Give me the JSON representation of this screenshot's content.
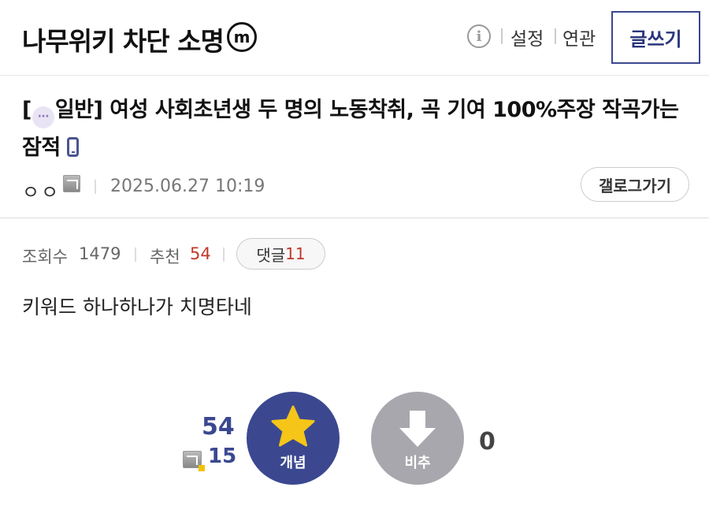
{
  "header": {
    "gallery_title": "나무위키 차단 소명",
    "gallery_badge": "m",
    "links": [
      "설정",
      "연관"
    ],
    "write_button": "글쓰기"
  },
  "post": {
    "category_open": "[",
    "category": "일반]",
    "title": "여성 사회초년생 두 명의 노동착취, 곡 기여 100%주장 작곡가는 잠적",
    "author": "ㅇㅇ",
    "date": "2025.06.27 10:19",
    "gallery_go": "갤로그가기"
  },
  "stats": {
    "views_label": "조회수",
    "views": "1479",
    "recommend_label": "추천",
    "recommend": "54",
    "comments_label": "댓글",
    "comments": "11"
  },
  "body": {
    "text": "키워드 하나하나가 치명타네"
  },
  "vote": {
    "up_count": "54",
    "fixed_count": "15",
    "up_label": "개념",
    "down_label": "비추",
    "down_count": "0"
  },
  "colors": {
    "accent": "#3b4890",
    "downvote": "#a7a7ad",
    "star": "#f5c518",
    "highlight": "#c0392b"
  }
}
